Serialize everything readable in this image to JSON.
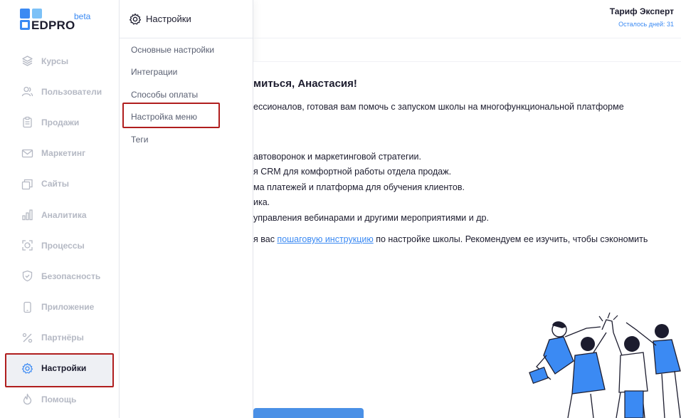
{
  "brand": {
    "name": "EDPRO",
    "badge": "beta"
  },
  "sidebar": {
    "items": [
      {
        "label": "Курсы",
        "icon": "layers-icon"
      },
      {
        "label": "Пользователи",
        "icon": "users-icon"
      },
      {
        "label": "Продажи",
        "icon": "clipboard-icon"
      },
      {
        "label": "Маркетинг",
        "icon": "mail-icon"
      },
      {
        "label": "Сайты",
        "icon": "windows-icon"
      },
      {
        "label": "Аналитика",
        "icon": "bar-chart-icon"
      },
      {
        "label": "Процессы",
        "icon": "process-icon"
      },
      {
        "label": "Безопасность",
        "icon": "shield-icon"
      },
      {
        "label": "Приложение",
        "icon": "phone-icon"
      },
      {
        "label": "Партнёры",
        "icon": "percent-icon"
      },
      {
        "label": "Настройки",
        "icon": "gear-icon",
        "active": true
      },
      {
        "label": "Помощь",
        "icon": "flame-icon"
      }
    ]
  },
  "submenu": {
    "title": "Настройки",
    "items": [
      "Основные настройки",
      "Интеграции",
      "Способы оплаты",
      "Настройка меню",
      "Теги"
    ],
    "highlighted": "Настройка меню"
  },
  "header": {
    "tariff": "Тариф Эксперт",
    "days_left": "Осталось дней: 31"
  },
  "main": {
    "greeting": "миться, Анастасия!",
    "intro": "ессионалов, готовая вам помочь с запуском школы на многофункциональной платформе",
    "bullets": [
      "автоворонок и маркетинговой стратегии.",
      "я CRM для комфортной работы отдела продаж.",
      "ма платежей и платформа для обучения клиентов.",
      "ика.",
      "управления вебинарами и другими мероприятиями и др."
    ],
    "guide_prefix": "я вас ",
    "guide_link": "пошаговую инструкцию",
    "guide_suffix": " по настройке школы. Рекомендуем ее изучить, чтобы сэкономить"
  },
  "colors": {
    "accent": "#3b8af3",
    "highlight_box": "#b01e1e",
    "muted": "#b5b9c4"
  }
}
